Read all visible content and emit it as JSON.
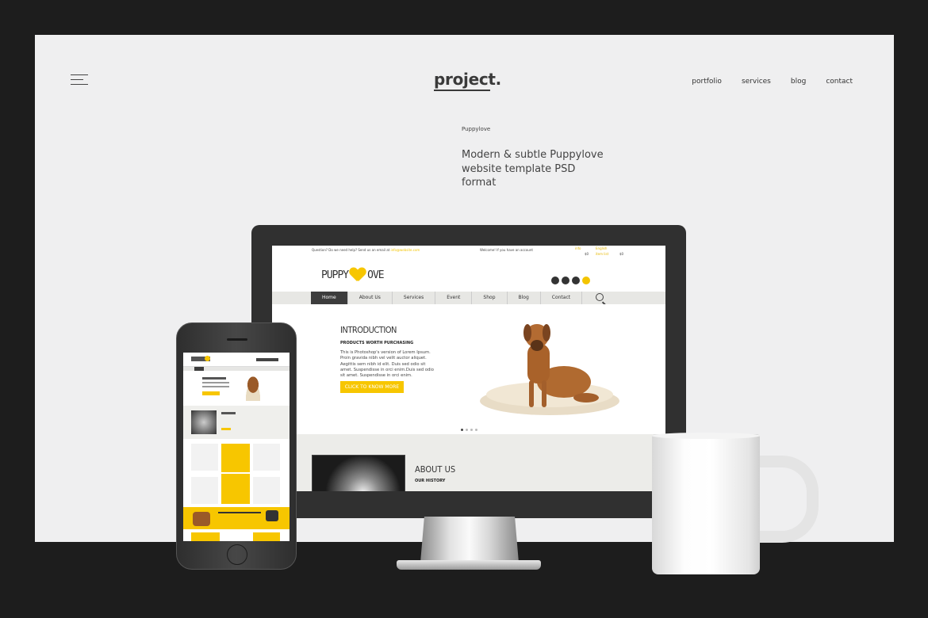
{
  "header": {
    "logo": "project.",
    "nav": [
      "portfolio",
      "services",
      "blog",
      "contact"
    ]
  },
  "project": {
    "label": "Puppylove",
    "title": "Modern & subtle Puppylove website template PSD format"
  },
  "mockup_site": {
    "topbar": {
      "question": "Question? Do we need help? Send us an email at",
      "email": "info@website.com",
      "welcome": "Welcome! If you have an account",
      "right_lines": [
        "info",
        "English",
        "$0",
        "item list",
        "$0"
      ]
    },
    "logo_left": "PUPPY",
    "logo_right": "OVE",
    "nav": [
      "Home",
      "About Us",
      "Services",
      "Event",
      "Shop",
      "Blog",
      "Contact"
    ],
    "hero": {
      "title": "INTRODUCTION",
      "subtitle": "PRODUCTS WORTH PURCHASING",
      "body": "This is Photoshop's version of Lorem Ipsum. Proin gravida nibh vel velit auctor aliquet. Aegittis sem nibh id elit. Duis sed odio sit amet. Suspendisse in orci enim.Duis sed odio sit amet. Suspendisse in orci enim.",
      "cta": "CLICK TO KNOW MORE"
    },
    "about": {
      "title": "ABOUT US",
      "subtitle": "OUR HISTORY"
    }
  },
  "colors": {
    "page_bg": "#efeff0",
    "outer_bg": "#1d1d1d",
    "accent_yellow": "#f7c600",
    "device_dark": "#303030"
  }
}
